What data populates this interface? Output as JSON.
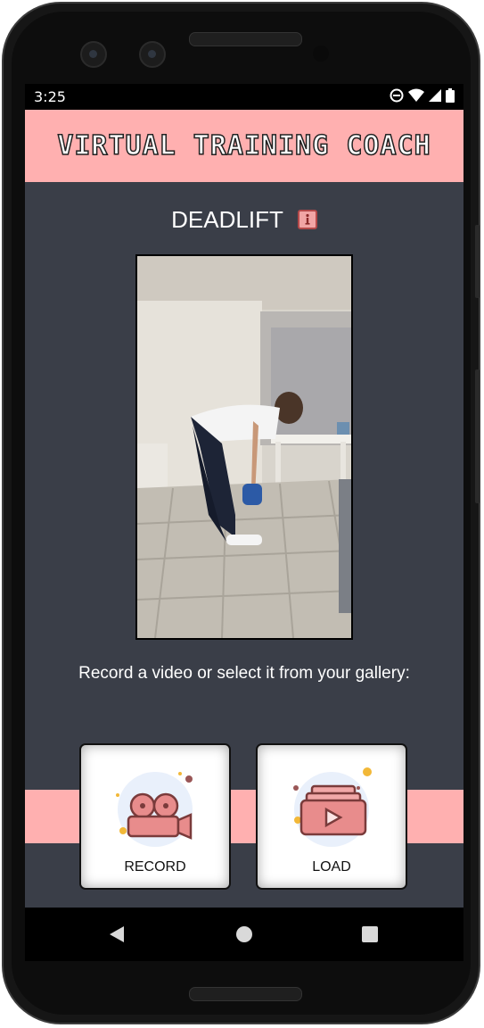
{
  "status": {
    "time": "3:25"
  },
  "app": {
    "title": "VIRTUAL TRAINING COACH"
  },
  "exercise": {
    "name": "DEADLIFT"
  },
  "instructions": "Record a video or select it from your gallery:",
  "actions": {
    "record_label": "RECORD",
    "load_label": "LOAD"
  },
  "colors": {
    "accent": "#ffb0b0",
    "background": "#3a3e48",
    "icon_primary": "#e88c8c",
    "icon_outline": "#7a3b3b"
  }
}
